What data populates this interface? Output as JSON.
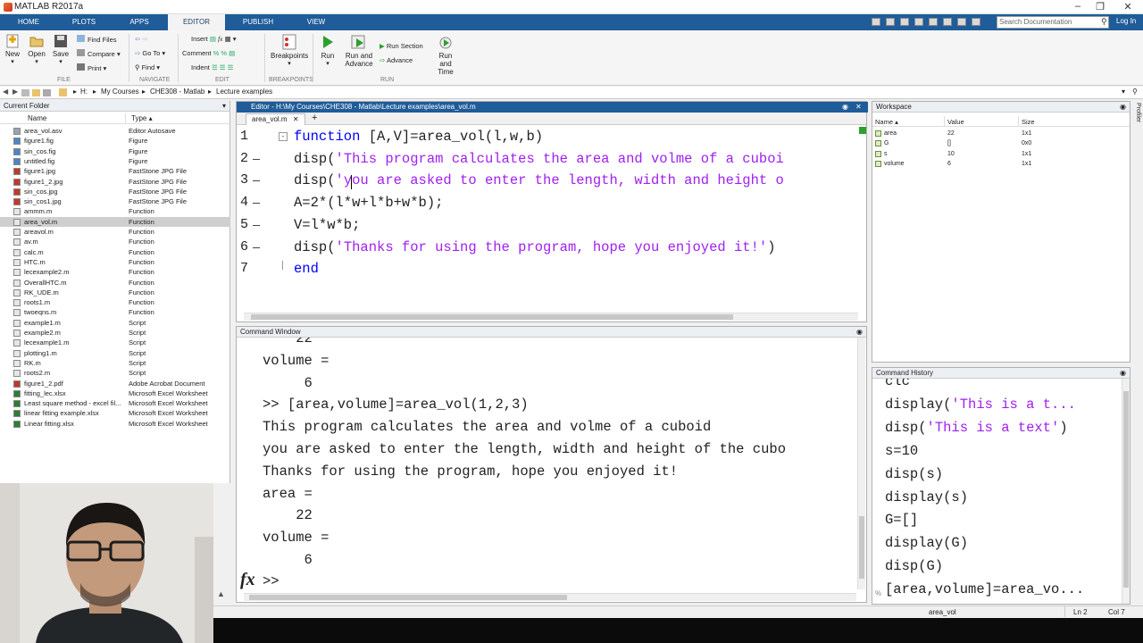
{
  "app": {
    "title": "MATLAB R2017a"
  },
  "tabs": [
    "HOME",
    "PLOTS",
    "APPS",
    "EDITOR",
    "PUBLISH",
    "VIEW"
  ],
  "ribbon": {
    "file": {
      "new": "New",
      "open": "Open",
      "save": "Save",
      "find_files": "Find Files",
      "compare": "Compare",
      "print": "Print",
      "section": "FILE"
    },
    "navigate": {
      "go_to": "Go To",
      "find": "Find",
      "section": "NAVIGATE"
    },
    "edit": {
      "insert": "Insert",
      "comment": "Comment",
      "indent": "Indent",
      "section": "EDIT"
    },
    "breakpoints": {
      "label": "Breakpoints",
      "section": "BREAKPOINTS"
    },
    "run": {
      "run": "Run",
      "run_and_advance": "Run and Advance",
      "run_section": "Run Section",
      "advance": "Advance",
      "run_and_time": "Run and Time",
      "section": "RUN"
    },
    "search_placeholder": "Search Documentation",
    "login": "Log In"
  },
  "address": {
    "drive": "H:",
    "crumbs": [
      "My Courses",
      "CHE308 - Matlab",
      "Lecture examples"
    ]
  },
  "current_folder": {
    "title": "Current Folder",
    "col_name": "Name",
    "col_type": "Type",
    "files": [
      {
        "name": "area_vol.asv",
        "type": "Editor Autosave",
        "icon": "doc"
      },
      {
        "name": "figure1.fig",
        "type": "Figure",
        "icon": "fig"
      },
      {
        "name": "sin_cos.fig",
        "type": "Figure",
        "icon": "fig"
      },
      {
        "name": "untitled.fig",
        "type": "Figure",
        "icon": "fig"
      },
      {
        "name": "figure1.jpg",
        "type": "FastStone JPG File",
        "icon": "jpg"
      },
      {
        "name": "figure1_2.jpg",
        "type": "FastStone JPG File",
        "icon": "jpg"
      },
      {
        "name": "sin_cos.jpg",
        "type": "FastStone JPG File",
        "icon": "jpg"
      },
      {
        "name": "sin_cos1.jpg",
        "type": "FastStone JPG File",
        "icon": "jpg"
      },
      {
        "name": "ammm.m",
        "type": "Function",
        "icon": "m"
      },
      {
        "name": "area_vol.m",
        "type": "Function",
        "icon": "m"
      },
      {
        "name": "areavol.m",
        "type": "Function",
        "icon": "m"
      },
      {
        "name": "av.m",
        "type": "Function",
        "icon": "m"
      },
      {
        "name": "calc.m",
        "type": "Function",
        "icon": "m"
      },
      {
        "name": "HTC.m",
        "type": "Function",
        "icon": "m"
      },
      {
        "name": "lecexample2.m",
        "type": "Function",
        "icon": "m"
      },
      {
        "name": "OverallHTC.m",
        "type": "Function",
        "icon": "m"
      },
      {
        "name": "RK_UDE.m",
        "type": "Function",
        "icon": "m"
      },
      {
        "name": "roots1.m",
        "type": "Function",
        "icon": "m"
      },
      {
        "name": "twoeqns.m",
        "type": "Function",
        "icon": "m"
      },
      {
        "name": "example1.m",
        "type": "Script",
        "icon": "m"
      },
      {
        "name": "example2.m",
        "type": "Script",
        "icon": "m"
      },
      {
        "name": "lecexample1.m",
        "type": "Script",
        "icon": "m"
      },
      {
        "name": "plotting1.m",
        "type": "Script",
        "icon": "m"
      },
      {
        "name": "RK.m",
        "type": "Script",
        "icon": "m"
      },
      {
        "name": "roots2.m",
        "type": "Script",
        "icon": "m"
      },
      {
        "name": "figure1_2.pdf",
        "type": "Adobe Acrobat Document",
        "icon": "pdf"
      },
      {
        "name": "fitting_lec.xlsx",
        "type": "Microsoft Excel Worksheet",
        "icon": "xls"
      },
      {
        "name": "Least square method - excel fil...",
        "type": "Microsoft Excel Worksheet",
        "icon": "xls"
      },
      {
        "name": "linear fitting example.xlsx",
        "type": "Microsoft Excel Worksheet",
        "icon": "xls"
      },
      {
        "name": "Linear fitting.xlsx",
        "type": "Microsoft Excel Worksheet",
        "icon": "xls"
      }
    ],
    "selected": "area_vol.m"
  },
  "editor": {
    "title": "Editor - H:\\My Courses\\CHE308 - Matlab\\Lecture examples\\area_vol.m",
    "tab": "area_vol.m",
    "lines": [
      {
        "n": "1",
        "kw": "function",
        "rest": " [A,V]=area_vol(l,w,b)"
      },
      {
        "n": "2",
        "pre": "disp(",
        "str": "'This program calculates the area and volme of a cuboi",
        "post": ""
      },
      {
        "n": "3",
        "pre": "disp(",
        "str": "'you are asked to enter the length, width and height o",
        "post": ""
      },
      {
        "n": "4",
        "plain": "A=2*(l*w+l*b+w*b);"
      },
      {
        "n": "5",
        "plain": "V=l*w*b;"
      },
      {
        "n": "6",
        "pre": "disp(",
        "str": "'Thanks for using the program, hope you enjoyed it!'",
        "post": ")"
      },
      {
        "n": "7",
        "kw": "end",
        "rest": ""
      }
    ]
  },
  "command_window": {
    "title": "Command Window",
    "lines": [
      "    22",
      "volume =",
      "     6",
      ">> [area,volume]=area_vol(1,2,3)",
      "This program calculates the area and volme of a cuboid",
      "you are asked to enter the length, width and height of the cubo",
      "Thanks for using the program, hope you enjoyed it!",
      "area =",
      "    22",
      "volume =",
      "     6"
    ],
    "prompt": ">>",
    "fx": "fx"
  },
  "workspace": {
    "title": "Workspace",
    "cols": [
      "Name",
      "Value",
      "Size"
    ],
    "vars": [
      {
        "name": "area",
        "value": "22",
        "size": "1x1"
      },
      {
        "name": "G",
        "value": "[]",
        "size": "0x0"
      },
      {
        "name": "s",
        "value": "10",
        "size": "1x1"
      },
      {
        "name": "volume",
        "value": "6",
        "size": "1x1"
      }
    ]
  },
  "history": {
    "title": "Command History",
    "lines": [
      {
        "plain": "clc"
      },
      {
        "pre": "display(",
        "str": "'This is a t..."
      },
      {
        "pre": "disp(",
        "str": "'This is a text'",
        "post": ")"
      },
      {
        "plain": "s=10"
      },
      {
        "plain": "disp(s)"
      },
      {
        "plain": "display(s)"
      },
      {
        "plain": "G=[]"
      },
      {
        "plain": "display(G)"
      },
      {
        "plain": "disp(G)"
      },
      {
        "plain": "[area,volume]=area_vo..."
      }
    ]
  },
  "status": {
    "function": "area_vol",
    "ln": "Ln 2",
    "col": "Col 7"
  },
  "colors": {
    "accent": "#1f5c99",
    "keyword": "#0000ff",
    "string": "#a020f0"
  }
}
